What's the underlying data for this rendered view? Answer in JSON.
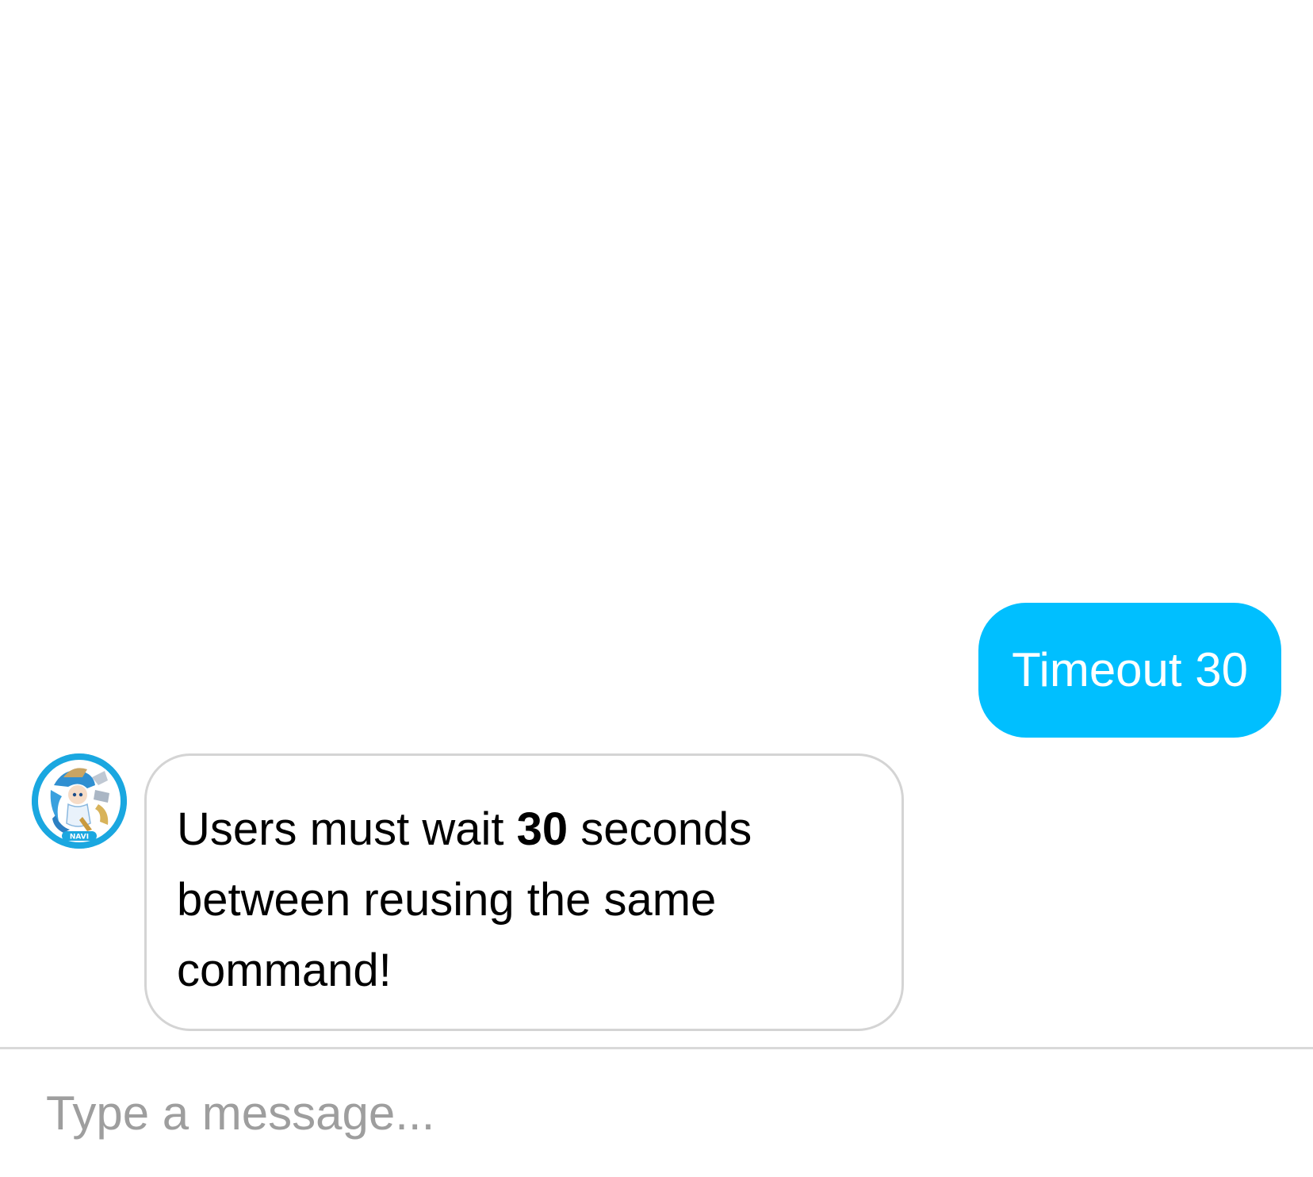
{
  "messages": {
    "user": {
      "text": "Timeout 30"
    },
    "bot": {
      "avatar_label": "NAVI",
      "text_before": "Users must wait ",
      "text_strong": "30",
      "text_after": " seconds between reusing the same command!"
    }
  },
  "composer": {
    "placeholder": "Type a message..."
  },
  "colors": {
    "user_bubble": "#00bfff",
    "bot_bubble_border": "#d4d4d4",
    "avatar_ring": "#1aa7e0"
  },
  "icons": {
    "avatar": "navi-avatar-icon"
  }
}
